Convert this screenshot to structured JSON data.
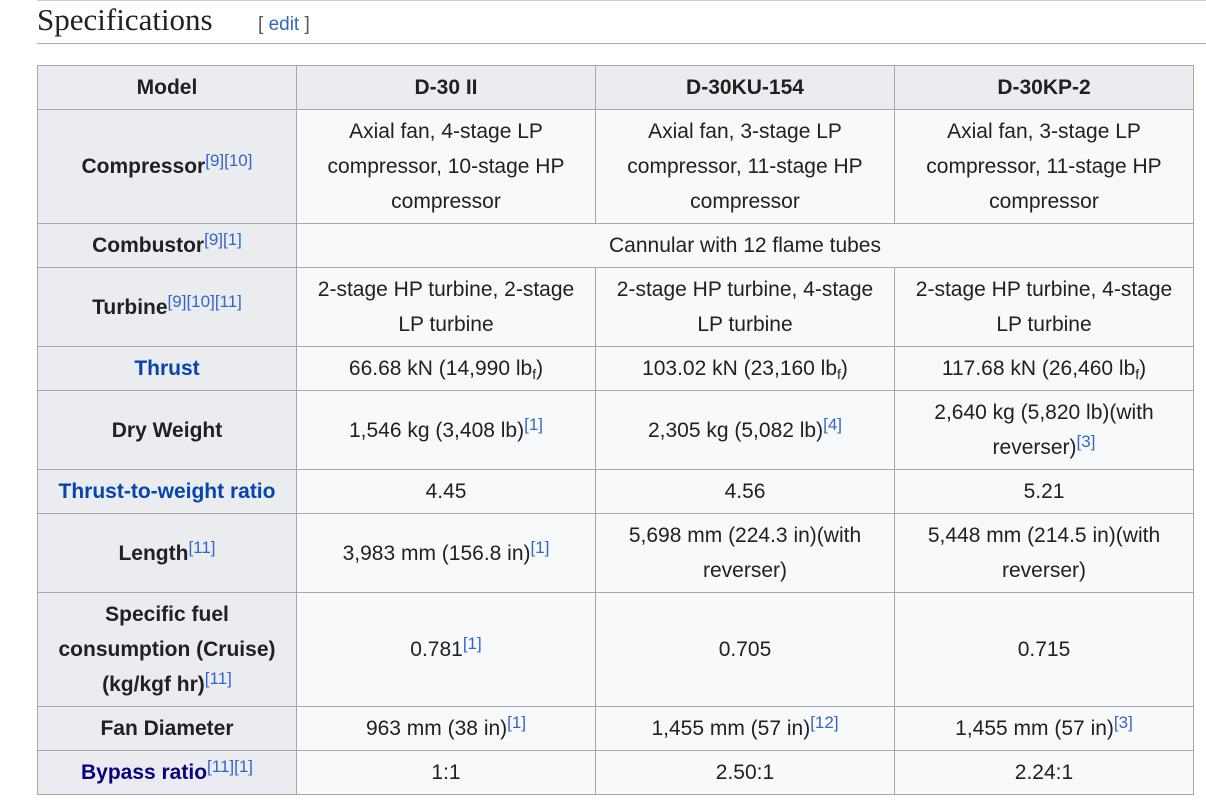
{
  "section": {
    "title": "Specifications",
    "edit_open": "[",
    "edit_label": "edit",
    "edit_close": "]"
  },
  "table": {
    "headers": [
      "Model",
      "D-30 II",
      "D-30KU-154",
      "D-30KP-2"
    ],
    "rows": {
      "compressor": {
        "label": "Compressor",
        "refs": [
          "[9]",
          "[10]"
        ],
        "c1": "Axial fan, 4-stage LP compressor, 10-stage HP compressor",
        "c2": "Axial fan, 3-stage LP compressor, 11-stage HP compressor",
        "c3": "Axial fan, 3-stage LP compressor, 11-stage HP compressor"
      },
      "combustor": {
        "label": "Combustor",
        "refs": [
          "[9]",
          "[1]"
        ],
        "value": "Cannular with 12 flame tubes"
      },
      "turbine": {
        "label": "Turbine",
        "refs": [
          "[9]",
          "[10]",
          "[11]"
        ],
        "c1": "2-stage HP turbine, 2-stage LP turbine",
        "c2": "2-stage HP turbine, 4-stage LP turbine",
        "c3": "2-stage HP turbine, 4-stage LP turbine"
      },
      "thrust": {
        "label": "Thrust",
        "c1": "66.68 kN (14,990 lb",
        "c1_sub": "f",
        "c1_end": ")",
        "c2": "103.02 kN (23,160 lb",
        "c2_sub": "f",
        "c2_end": ")",
        "c3": "117.68 kN (26,460 lb",
        "c3_sub": "f",
        "c3_end": ")"
      },
      "dry_weight": {
        "label": "Dry Weight",
        "c1": "1,546 kg (3,408 lb)",
        "c1_ref": "[1]",
        "c2": "2,305 kg (5,082 lb)",
        "c2_ref": "[4]",
        "c3": "2,640 kg (5,820 lb)(with reverser)",
        "c3_ref": "[3]"
      },
      "twr": {
        "label": "Thrust-to-weight ratio",
        "c1": "4.45",
        "c2": "4.56",
        "c3": "5.21"
      },
      "length": {
        "label": "Length",
        "refs": [
          "[11]"
        ],
        "c1": "3,983 mm (156.8 in)",
        "c1_ref": "[1]",
        "c2": "5,698 mm (224.3 in)(with reverser)",
        "c3": "5,448 mm (214.5 in)(with reverser)"
      },
      "sfc": {
        "label": "Specific fuel consumption (Cruise) (kg/kgf hr)",
        "refs": [
          "[11]"
        ],
        "c1": "0.781",
        "c1_ref": "[1]",
        "c2": "0.705",
        "c3": "0.715"
      },
      "fan": {
        "label": "Fan Diameter",
        "c1": "963 mm (38 in)",
        "c1_ref": "[1]",
        "c2": "1,455 mm (57 in)",
        "c2_ref": "[12]",
        "c3": "1,455 mm (57 in)",
        "c3_ref": "[3]"
      },
      "bypass": {
        "label": "Bypass ratio",
        "refs": [
          "[11]",
          "[1]"
        ],
        "c1": "1:1",
        "c2": "2.50:1",
        "c3": "2.24:1"
      }
    }
  }
}
